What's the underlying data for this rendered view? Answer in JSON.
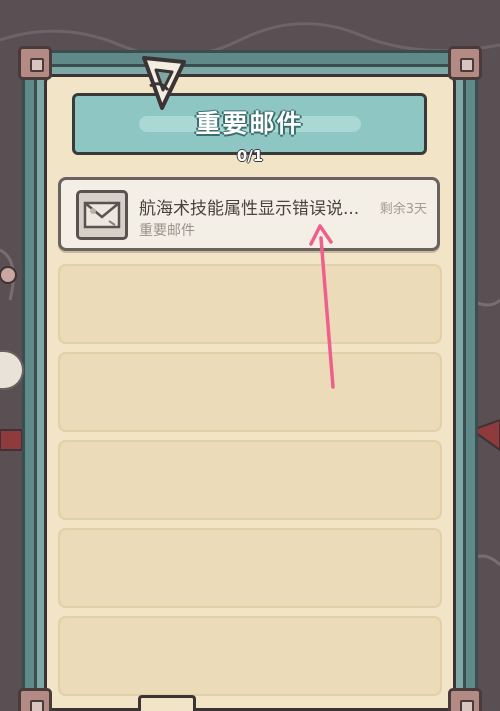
{
  "header": {
    "title": "重要邮件",
    "counter": "0/1"
  },
  "mail_list": {
    "items": [
      {
        "title": "航海术技能属性显示错误说...",
        "category": "重要邮件",
        "expire": "剩余3天",
        "icon": "envelope-icon"
      }
    ],
    "empty_slots": 5
  },
  "colors": {
    "frame": "#5f8a89",
    "header": "#8ec6c4",
    "paper": "#f2e4c7",
    "slot": "#ecdbb9",
    "annotation_arrow": "#ee5f8c"
  }
}
